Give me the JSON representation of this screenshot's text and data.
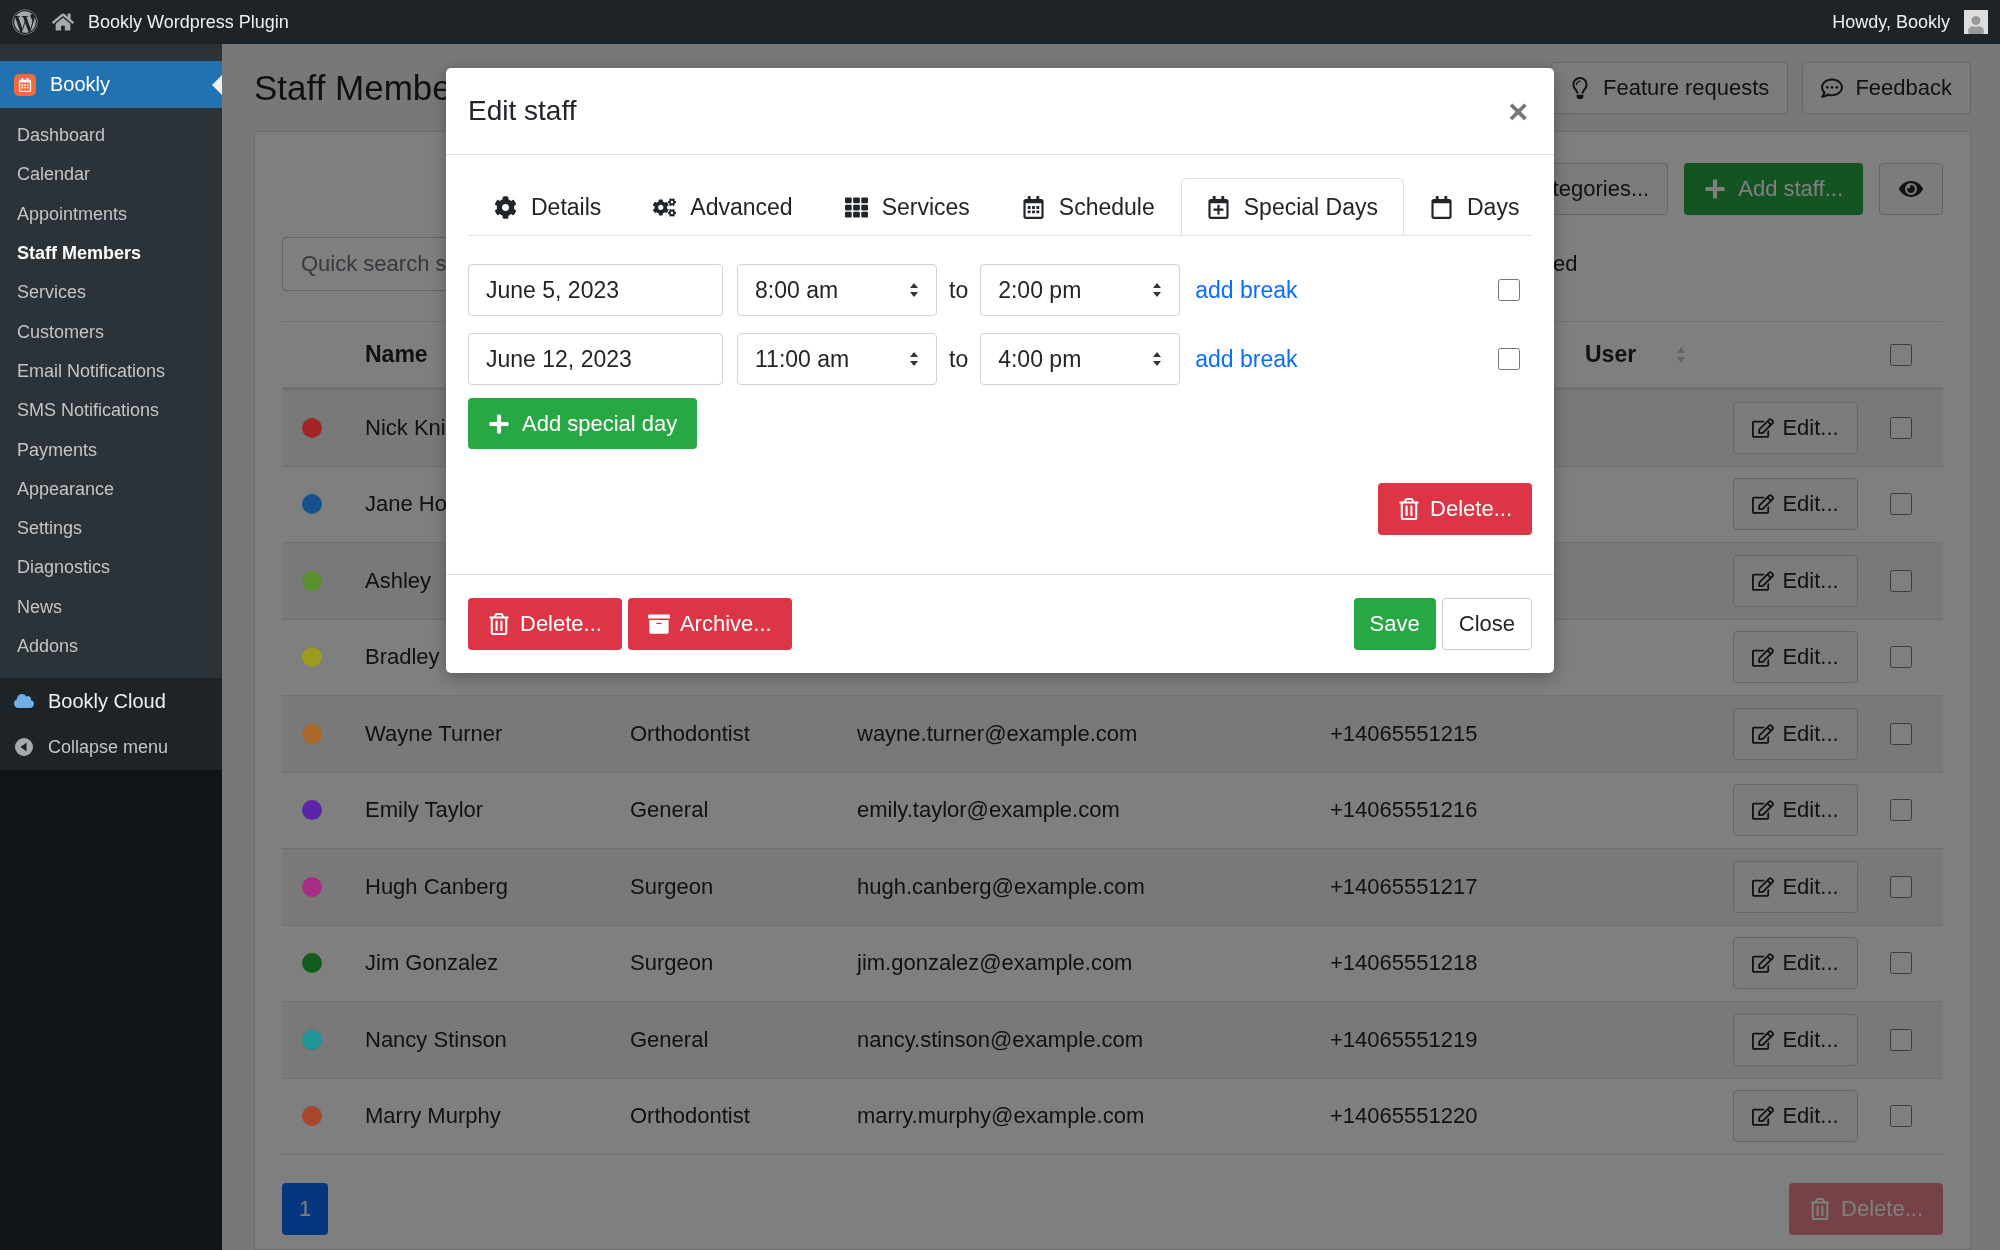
{
  "topbar": {
    "site_title": "Bookly Wordpress Plugin",
    "greeting": "Howdy, Bookly"
  },
  "sidebar": {
    "plugin": {
      "label": "Bookly",
      "selected": true
    },
    "items": [
      {
        "label": "Dashboard",
        "selected": false
      },
      {
        "label": "Calendar",
        "selected": false
      },
      {
        "label": "Appointments",
        "selected": false
      },
      {
        "label": "Staff Members",
        "selected": true
      },
      {
        "label": "Services",
        "selected": false
      },
      {
        "label": "Customers",
        "selected": false
      },
      {
        "label": "Email Notifications",
        "selected": false
      },
      {
        "label": "SMS Notifications",
        "selected": false
      },
      {
        "label": "Payments",
        "selected": false
      },
      {
        "label": "Appearance",
        "selected": false
      },
      {
        "label": "Settings",
        "selected": false
      },
      {
        "label": "Diagnostics",
        "selected": false
      },
      {
        "label": "News",
        "selected": false
      },
      {
        "label": "Addons",
        "selected": false
      }
    ],
    "cloud": "Bookly Cloud",
    "collapse": "Collapse menu"
  },
  "page": {
    "title": "Staff Membe",
    "header_buttons": [
      {
        "label": "Feature requests",
        "kind": "idea"
      },
      {
        "label": "Feedback",
        "kind": "comment"
      }
    ]
  },
  "toolbar": {
    "categories_button": "tegories...",
    "add_button": "Add staff..."
  },
  "search": {
    "placeholder": "Quick search s"
  },
  "filter_text": "ed",
  "table": {
    "columns": [
      "Name",
      "User"
    ],
    "header_checked": false,
    "rows": [
      {
        "color": "#a32424",
        "name": "Nick Kni",
        "edit": "Edit...",
        "checked": false
      },
      {
        "color": "#15508c",
        "name": "Jane Ho",
        "edit": "Edit...",
        "checked": false
      },
      {
        "color": "#5a8f2e",
        "name": "Ashley",
        "edit": "Edit...",
        "checked": false
      },
      {
        "color": "#9c9a1f",
        "name": "Bradley",
        "edit": "Edit...",
        "checked": false
      },
      {
        "color": "#a8692a",
        "name": "Wayne Turner",
        "position": "Orthodontist",
        "email": "wayne.turner@example.com",
        "phone": "+14065551215",
        "edit": "Edit...",
        "checked": false
      },
      {
        "color": "#5a25a8",
        "name": "Emily Taylor",
        "position": "General",
        "email": "emily.taylor@example.com",
        "phone": "+14065551216",
        "edit": "Edit...",
        "checked": false
      },
      {
        "color": "#a82c86",
        "name": "Hugh Canberg",
        "position": "Surgeon",
        "email": "hugh.canberg@example.com",
        "phone": "+14065551217",
        "edit": "Edit...",
        "checked": false
      },
      {
        "color": "#125c1e",
        "name": "Jim Gonzalez",
        "position": "Surgeon",
        "email": "jim.gonzalez@example.com",
        "phone": "+14065551218",
        "edit": "Edit...",
        "checked": false
      },
      {
        "color": "#1f9499",
        "name": "Nancy Stinson",
        "position": "General",
        "email": "nancy.stinson@example.com",
        "phone": "+14065551219",
        "edit": "Edit...",
        "checked": false
      },
      {
        "color": "#a4472a",
        "name": "Marry Murphy",
        "position": "Orthodontist",
        "email": "marry.murphy@example.com",
        "phone": "+14065551220",
        "edit": "Edit...",
        "checked": false
      }
    ]
  },
  "pagination": [
    {
      "label": "1",
      "selected": true
    }
  ],
  "bulk_delete": {
    "label": "Delete...",
    "disabled": true
  },
  "modal": {
    "title": "Edit staff",
    "close": "×",
    "tabs": [
      {
        "label": "Details",
        "kind": "gear",
        "selected": false
      },
      {
        "label": "Advanced",
        "kind": "gears",
        "selected": false
      },
      {
        "label": "Services",
        "kind": "grid",
        "selected": false
      },
      {
        "label": "Schedule",
        "kind": "calendar",
        "selected": false
      },
      {
        "label": "Special Days",
        "kind": "calendar-plus",
        "selected": true
      },
      {
        "label": "Days",
        "kind": "calendar-empty",
        "selected": false
      }
    ],
    "special_days": [
      {
        "date": "June 5, 2023",
        "start": "8:00 am",
        "separator": "to",
        "end": "2:00 pm",
        "break_link": "add break",
        "checked": false
      },
      {
        "date": "June 12, 2023",
        "start": "11:00 am",
        "separator": "to",
        "end": "4:00 pm",
        "break_link": "add break",
        "checked": false
      }
    ],
    "add_button": "Add special day",
    "delete_day_button": "Delete...",
    "footer": {
      "delete": "Delete...",
      "archive": "Archive...",
      "save": "Save",
      "close": "Close"
    }
  }
}
